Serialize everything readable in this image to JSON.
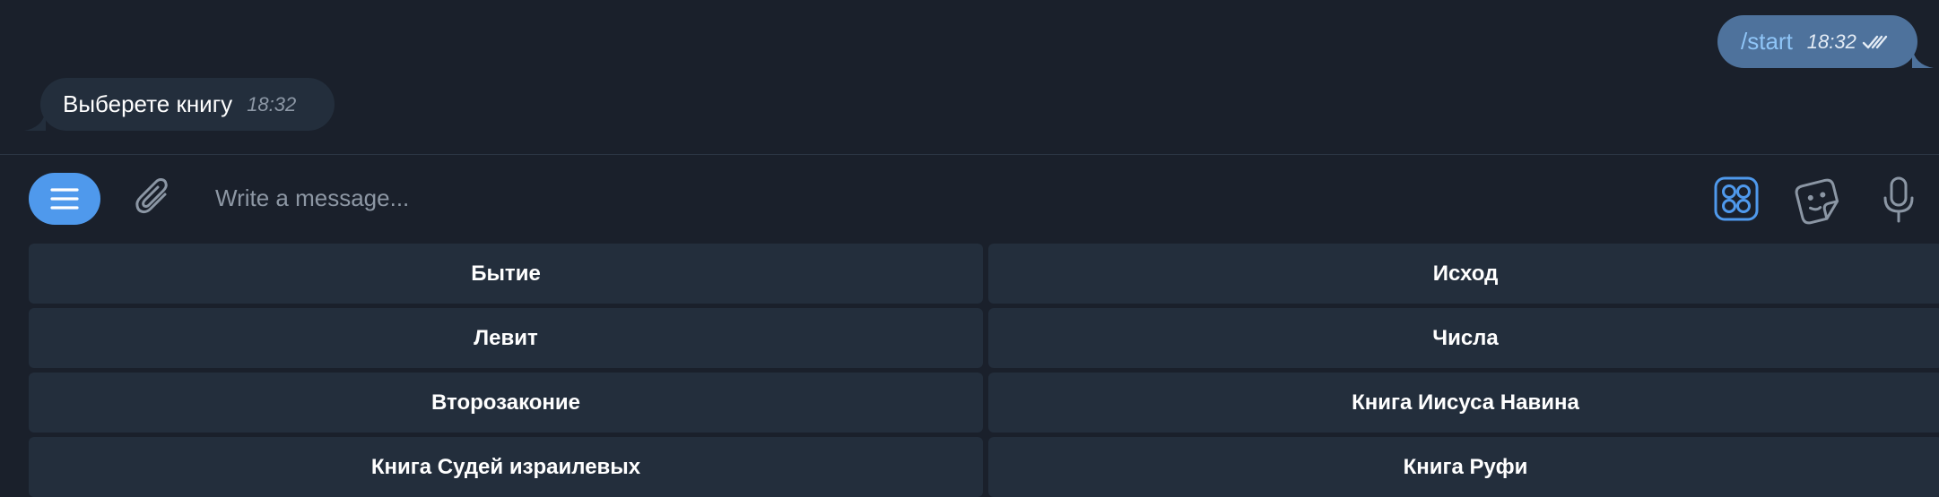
{
  "chat": {
    "messages": [
      {
        "direction": "outgoing",
        "text": "/start",
        "time": "18:32",
        "status": "read-double-check"
      },
      {
        "direction": "incoming",
        "text": "Выберете книгу",
        "time": "18:32"
      }
    ]
  },
  "composer": {
    "placeholder": "Write a message...",
    "icons": {
      "menu": "menu-hamburger-icon",
      "attach": "paperclip-icon",
      "keyboard": "bot-keyboard-icon",
      "sticker": "sticker-emoji-icon",
      "mic": "microphone-icon"
    }
  },
  "keyboard": {
    "buttons": [
      [
        "Бытие",
        "Исход"
      ],
      [
        "Левит",
        "Числа"
      ],
      [
        "Второзаконие",
        "Книга Иисуса Навина"
      ],
      [
        "Книга Судей израилевых",
        "Книга Руфи"
      ]
    ]
  },
  "colors": {
    "background": "#1a202b",
    "outgoing_bubble": "#4e729c",
    "incoming_bubble": "#232e3c",
    "accent": "#4f99ec",
    "keyboard_button": "#232e3c"
  }
}
